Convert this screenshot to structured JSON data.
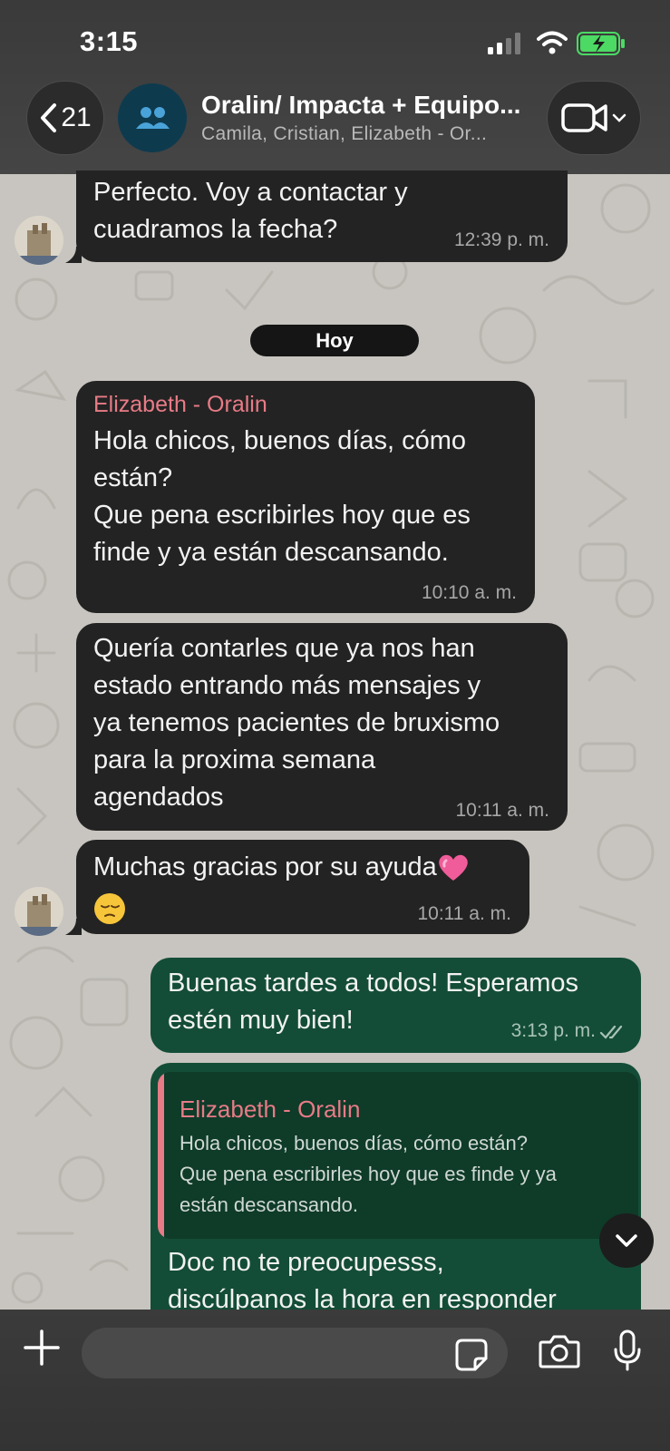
{
  "status_bar": {
    "time": "3:15"
  },
  "header": {
    "back_count": "21",
    "title": "Oralin/ Impacta + Equipo...",
    "members": "Camila, Cristian, Elizabeth - Or..."
  },
  "messages": {
    "m1": {
      "text_line1": "Perfecto. Voy a contactar y",
      "text_line2": "cuadramos la fecha?",
      "time": "12:39 p. m."
    },
    "day_separator": "Hoy",
    "m2": {
      "sender": "Elizabeth - Oralin",
      "line1": "Hola chicos, buenos días, cómo",
      "line2": "están?",
      "line3": "Que pena escribirles hoy que es",
      "line4": "finde y ya están descansando.",
      "time": "10:10 a. m."
    },
    "m3": {
      "line1": "Quería contarles que ya nos han",
      "line2": "estado entrando más mensajes y",
      "line3": "ya tenemos pacientes de bruxismo",
      "line4": "para la proxima semana",
      "line5": "agendados",
      "time": "10:11 a. m."
    },
    "m4": {
      "text": "Muchas gracias por su ayuda",
      "time": "10:11 a. m."
    },
    "m5": {
      "line1": "Buenas tardes a todos! Esperamos",
      "line2": "estén muy bien!",
      "time": "3:13 p. m."
    },
    "m6": {
      "quote_sender": "Elizabeth - Oralin",
      "quote_line1": "Hola chicos, buenos días, cómo están?",
      "quote_line2": "Que pena escribirles hoy que es finde y ya",
      "quote_line3": "están descansando.",
      "line1": "Doc no te preocupesss,",
      "line2": "discúlpanos la hora en responder"
    }
  },
  "icons": {
    "back": "chevron-left-icon",
    "group": "group-icon",
    "video": "video-call-icon",
    "plus": "plus-icon",
    "sticker": "sticker-icon",
    "camera": "camera-icon",
    "mic": "microphone-icon",
    "read": "double-check-icon",
    "scroll": "chevron-down-icon"
  },
  "colors": {
    "incoming_bubble": "#232323",
    "outgoing_bubble": "#144d37",
    "sender_name": "#e87b86",
    "header_bg": "#3a3a3a"
  }
}
